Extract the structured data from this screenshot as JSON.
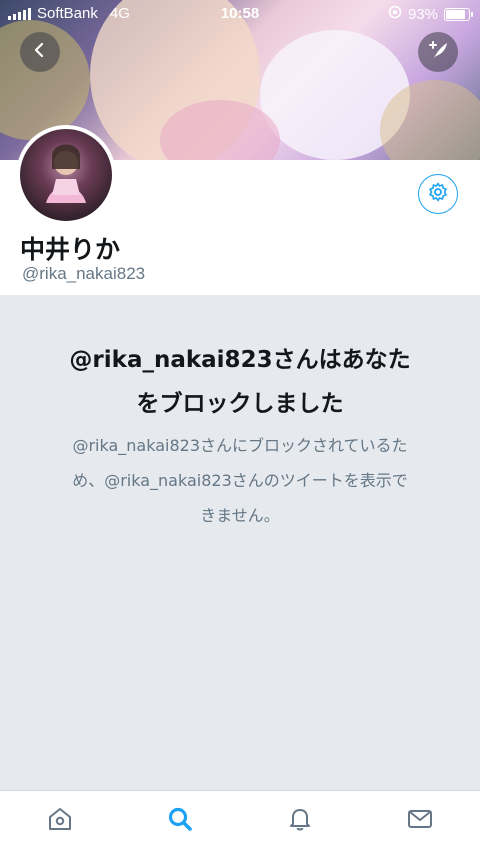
{
  "status_bar": {
    "carrier": "SoftBank",
    "network": "4G",
    "time": "10:58",
    "battery": "93%",
    "battery_level": 0.93
  },
  "header": {
    "back_icon": "chevron-left-icon",
    "compose_icon": "compose-feather-icon"
  },
  "profile": {
    "display_name": "中井りか",
    "handle": "@rika_nakai823",
    "settings_icon": "gear-icon"
  },
  "blocked": {
    "title_line1": "@rika_nakai823さんはあなた",
    "title_line2": "をブロックしました",
    "desc_line1": "@rika_nakai823さんにブロックされているた",
    "desc_line2": "め、@rika_nakai823さんのツイートを表示で",
    "desc_line3": "きません。"
  },
  "tabbar": {
    "tabs": [
      {
        "name": "home",
        "icon": "home-icon",
        "active": false
      },
      {
        "name": "search",
        "icon": "search-icon",
        "active": true
      },
      {
        "name": "notifications",
        "icon": "bell-icon",
        "active": false
      },
      {
        "name": "messages",
        "icon": "mail-icon",
        "active": false
      }
    ]
  },
  "colors": {
    "accent": "#1da1f2",
    "inactive_icon": "#657786",
    "background": "#e6e9ee"
  }
}
